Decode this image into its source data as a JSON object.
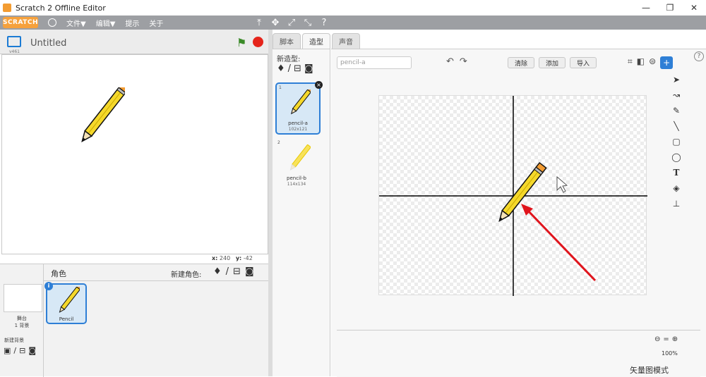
{
  "window": {
    "title": "Scratch 2 Offline Editor",
    "min": "—",
    "max": "❐",
    "close": "✕"
  },
  "menubar": {
    "logo": "SCRATCH",
    "items": [
      "文件▼",
      "编辑▼",
      "提示",
      "关于"
    ],
    "tools": [
      "⤒",
      "✥",
      "⤢",
      "⤡",
      "?"
    ]
  },
  "stage": {
    "version": "v461",
    "project_title": "Untitled",
    "coords_x_label": "x:",
    "coords_x": "240",
    "coords_y_label": "y:",
    "coords_y": "-42"
  },
  "sprites": {
    "header": "角色",
    "new_sprite_label": "新建角色:",
    "stage_label": "舞台",
    "stage_count": "1 背景",
    "new_backdrop_label": "新建背景",
    "sprite_name": "Pencil"
  },
  "tabs": [
    "脚本",
    "造型",
    "声音"
  ],
  "costumes": {
    "new_costume_label": "新造型:",
    "items": [
      {
        "num": "1",
        "name": "pencil-a",
        "size": "102x121"
      },
      {
        "num": "2",
        "name": "pencil-b",
        "size": "114x134"
      }
    ]
  },
  "editor": {
    "name_value": "pencil-a",
    "buttons": [
      "清除",
      "添加",
      "导入"
    ],
    "zoom": "100%",
    "mode": "矢量图模式"
  },
  "colors": {
    "menubar": "#9d9fa3",
    "accent": "#2e7fd6",
    "pencil_body": "#f5d82a",
    "arrow": "#e0141c"
  }
}
